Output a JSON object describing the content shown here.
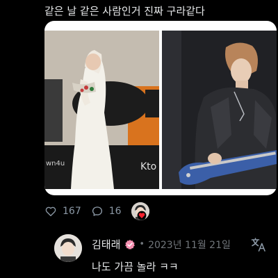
{
  "tweet": {
    "text": "같은 날 같은 사람인거 진짜 구라같다",
    "likes": "167",
    "replies": "16"
  },
  "media": {
    "left_sign_a": "wn4u",
    "left_sign_b": "Kto"
  },
  "reply": {
    "name": "김태래",
    "dot": "•",
    "date": "2023년 11월 21일",
    "text": "나도 가끔 놀라 ㅋㅋ"
  },
  "icons": {
    "like": "heart-outline-icon",
    "reply": "speech-bubble-icon",
    "verified": "pink-verified-badge-icon",
    "translate": "translate-icon"
  },
  "colors": {
    "background": "#000000",
    "text": "#e7e9ea",
    "muted": "#8b98a5",
    "verified": "#f58fb0",
    "heart_red": "#f4212e"
  }
}
